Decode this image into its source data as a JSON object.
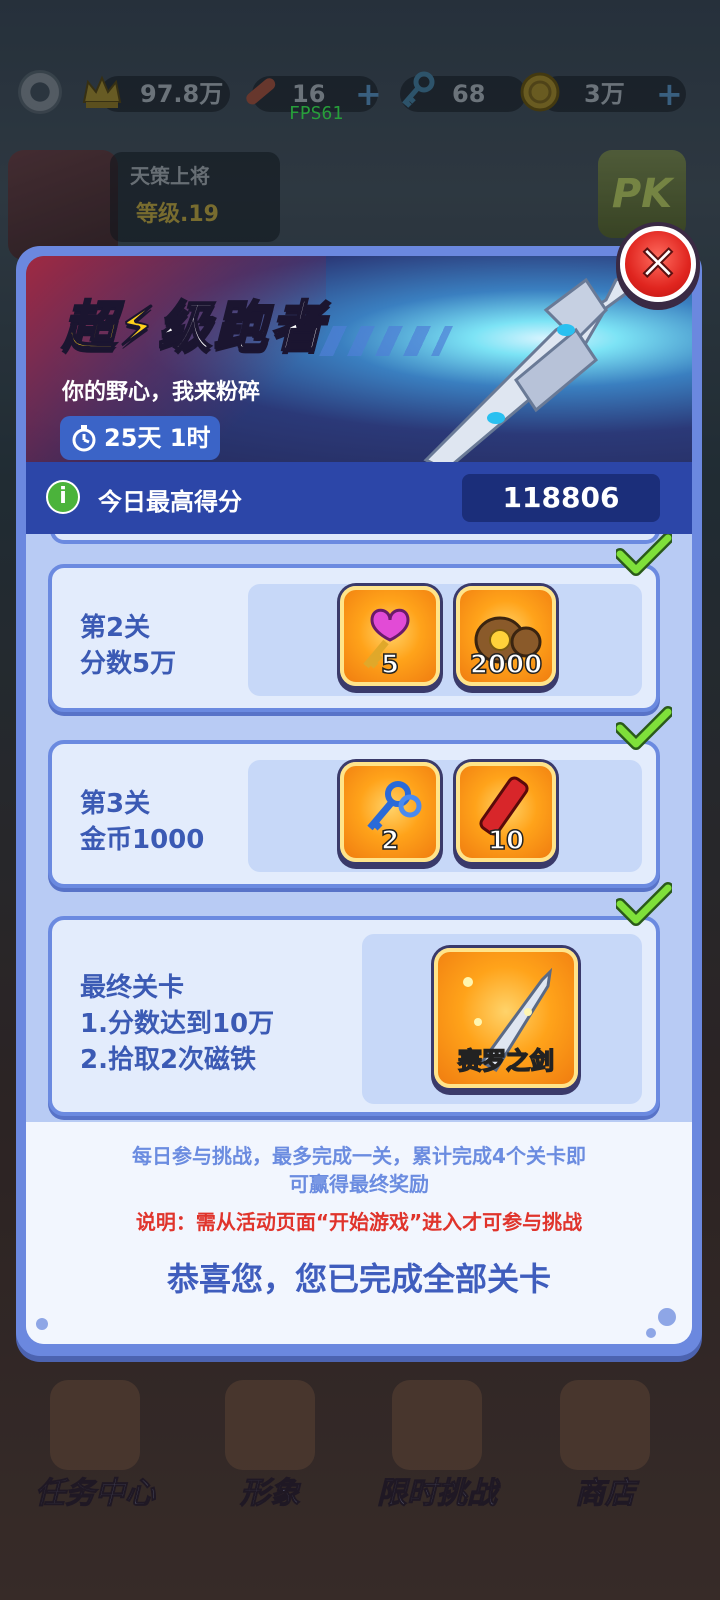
{
  "hud": {
    "trophy_value": "97.8万",
    "skateboard_value": "16",
    "key_value": "68",
    "coin_value": "3万",
    "fps": "FPS61"
  },
  "profile": {
    "name": "天策上将",
    "level": "等级.19"
  },
  "pk_label": "PK",
  "event": {
    "title_first": "超",
    "title_rest": "级跑者",
    "subtitle": "你的野心，我来粉碎",
    "timer": "25天 1时"
  },
  "score": {
    "label": "今日最高得分",
    "value": "118806"
  },
  "stages": [
    {
      "text": "第2关\n分数5万",
      "completed": true,
      "rewards": [
        {
          "icon": "pink-heart-key-icon",
          "count": "5"
        },
        {
          "icon": "coin-bag-icon",
          "count": "2000"
        }
      ]
    },
    {
      "text": "第3关\n金币1000",
      "completed": true,
      "rewards": [
        {
          "icon": "blue-keys-icon",
          "count": "2"
        },
        {
          "icon": "firecracker-icon",
          "count": "10"
        }
      ]
    },
    {
      "text": "最终关卡\n1.分数达到10万\n2.拾取2次磁铁",
      "completed": true,
      "rewards": [
        {
          "icon": "sword-icon",
          "count": "赛罗之剑"
        }
      ]
    }
  ],
  "footer": {
    "note_line1": "每日参与挑战，最多完成一关，累计完成4个关卡即",
    "note_line2": "可赢得最终奖励",
    "warning": "说明：需从活动页面“开始游戏”进入才可参与挑战",
    "done": "恭喜您，您已完成全部关卡"
  },
  "nav": [
    {
      "label": "任务中心",
      "icon": "trophy-icon"
    },
    {
      "label": "形象",
      "icon": "character-icon"
    },
    {
      "label": "限时挑战",
      "icon": "calendar-icon"
    },
    {
      "label": "商店",
      "icon": "shop-bag-icon"
    }
  ],
  "colors": {
    "dialog_border": "#6b88df",
    "score_bar": "#2c46a8",
    "stage_text": "#3b5ab4",
    "warning": "#e0342c",
    "check": "#5cc22c"
  }
}
